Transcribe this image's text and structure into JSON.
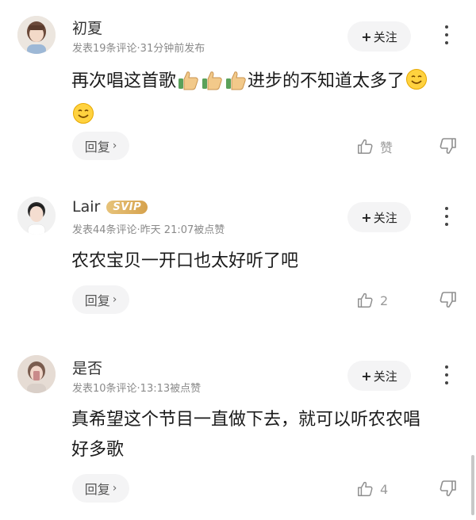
{
  "comments": [
    {
      "username": "初夏",
      "meta": "发表19条评论·31分钟前发布",
      "follow_label": "关注",
      "content_text": "再次唱这首歌",
      "content_text_2": "进步的不知道太多了",
      "emojis": [
        "thumbs-up-icon",
        "thumbs-up-icon",
        "thumbs-up-icon",
        "smile-icon",
        "smile-icon"
      ],
      "reply_label": "回复",
      "like_label": "赞"
    },
    {
      "username": "Lair",
      "badge": "SVIP",
      "meta": "发表44条评论·昨天 21:07被点赞",
      "follow_label": "关注",
      "content_text": "农农宝贝一开口也太好听了吧",
      "reply_label": "回复",
      "like_count": "2"
    },
    {
      "username": "是否",
      "meta": "发表10条评论·13:13被点赞",
      "follow_label": "关注",
      "content_text": "真希望这个节目一直做下去，就可以听农农唱",
      "content_text_2": "好多歌",
      "reply_label": "回复",
      "like_count": "4"
    }
  ],
  "colors": {
    "accent_badge": "#d6a24d",
    "button_bg": "#f4f4f5",
    "meta_text": "#8a8a8a"
  }
}
